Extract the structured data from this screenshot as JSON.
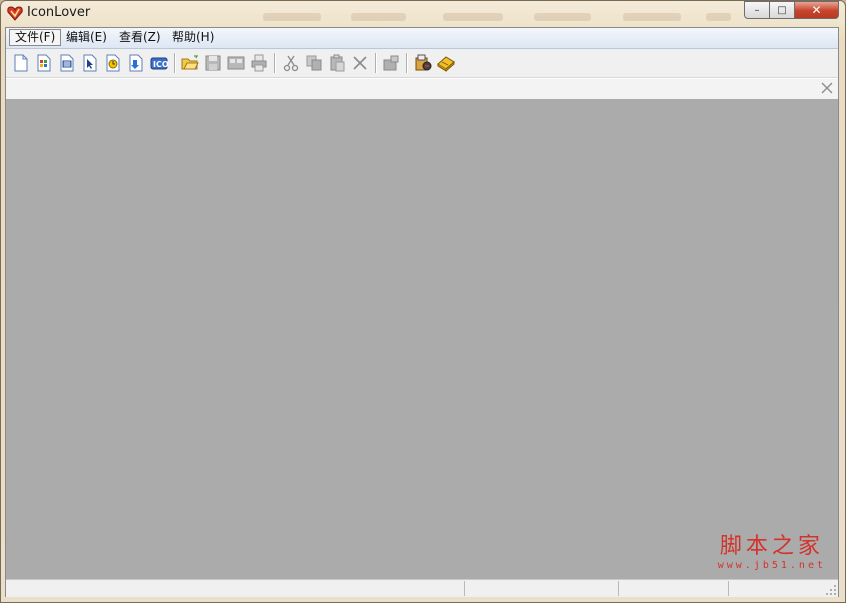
{
  "window": {
    "title": "IconLover"
  },
  "window_controls": {
    "minimize": "–",
    "maximize": "□",
    "close": "✕"
  },
  "menubar": {
    "items": [
      {
        "label": "文件(F)"
      },
      {
        "label": "编辑(E)"
      },
      {
        "label": "查看(Z)"
      },
      {
        "label": "帮助(H)"
      }
    ]
  },
  "toolbar": {
    "buttons": [
      {
        "icon": "new-document-icon"
      },
      {
        "icon": "new-icon-library-icon"
      },
      {
        "icon": "new-toolbar-image-icon"
      },
      {
        "icon": "new-cursor-icon"
      },
      {
        "icon": "new-animated-cursor-icon"
      },
      {
        "icon": "new-image-list-icon"
      },
      {
        "icon": "icq-icon"
      },
      {
        "icon": "open-folder-icon"
      },
      {
        "icon": "save-icon"
      },
      {
        "icon": "save-all-icon"
      },
      {
        "icon": "print-icon"
      },
      {
        "icon": "cut-icon"
      },
      {
        "icon": "copy-icon"
      },
      {
        "icon": "paste-icon"
      },
      {
        "icon": "delete-icon"
      },
      {
        "icon": "properties-icon"
      },
      {
        "icon": "resource-extractor-icon"
      },
      {
        "icon": "help-book-icon"
      }
    ]
  },
  "watermark": {
    "main": "脚本之家",
    "sub": "www.jb51.net"
  },
  "colors": {
    "workspace": "#ababab",
    "menubar": "#dde6f3",
    "close_button": "#c7432b",
    "watermark": "#d2342c"
  }
}
